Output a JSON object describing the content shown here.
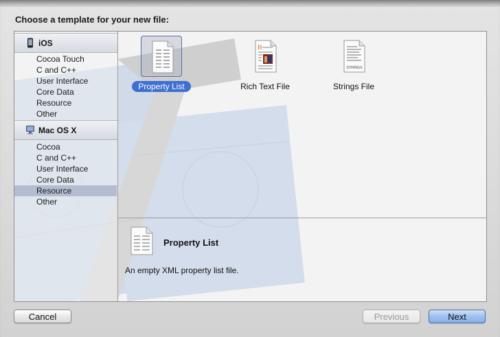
{
  "dialog": {
    "heading": "Choose a template for your new file:"
  },
  "sidebar": {
    "groups": [
      {
        "label": "iOS",
        "icon": "iphone-icon",
        "items": [
          "Cocoa Touch",
          "C and C++",
          "User Interface",
          "Core Data",
          "Resource",
          "Other"
        ]
      },
      {
        "label": "Mac OS X",
        "icon": "mac-icon",
        "items": [
          "Cocoa",
          "C and C++",
          "User Interface",
          "Core Data",
          "Resource",
          "Other"
        ],
        "selected_item": "Resource"
      }
    ]
  },
  "templates": [
    {
      "label": "Property List",
      "icon": "property-list-file-icon",
      "selected": true
    },
    {
      "label": "Rich Text File",
      "icon": "rich-text-file-icon",
      "selected": false
    },
    {
      "label": "Strings File",
      "icon": "strings-file-icon",
      "badge": "STRINGS",
      "selected": false
    }
  ],
  "details": {
    "title": "Property List",
    "description": "An empty XML property list file.",
    "icon": "property-list-file-icon"
  },
  "buttons": {
    "cancel": "Cancel",
    "previous": "Previous",
    "next": "Next"
  },
  "colors": {
    "selection_blue": "#3f6fd1",
    "sidebar_selection": "#b4bdcf",
    "primary_button": "#9fc0ee"
  }
}
